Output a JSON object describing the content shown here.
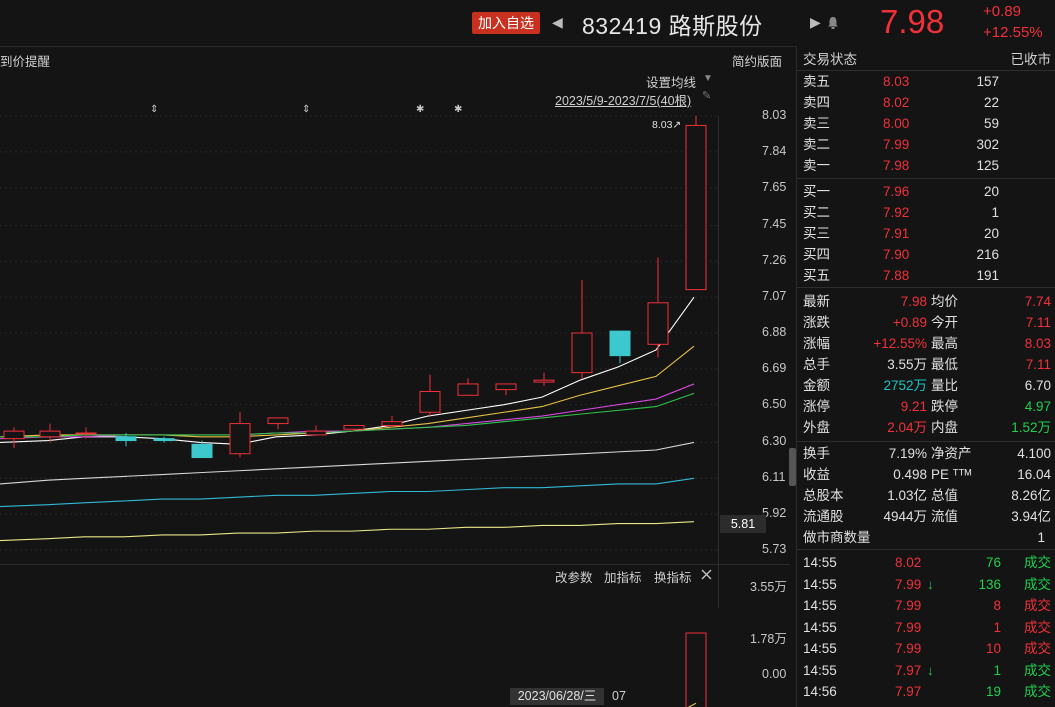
{
  "header": {
    "add_watch_label": "加入自选",
    "prev_arrow": "◀",
    "next_arrow": "▶",
    "code_name": "832419 路斯股份",
    "bell_icon": "bell-icon",
    "price": "7.98",
    "change": "+0.89",
    "change_pct": "+12.55%"
  },
  "chart": {
    "price_alert": "到价提醒",
    "simple_layout": "简约版面",
    "set_ma": "设置均线",
    "date_range": "2023/5/9-2023/7/5(40根)",
    "high_marker": "8.03",
    "current_price_tag": "5.81",
    "y_ticks": [
      "8.03",
      "7.84",
      "7.65",
      "7.45",
      "7.26",
      "7.07",
      "6.88",
      "6.69",
      "6.50",
      "6.30",
      "6.11",
      "5.92",
      "5.73"
    ],
    "indicator_menu": [
      "改参数",
      "加指标",
      "换指标"
    ],
    "close_icon": "close-icon",
    "vol_ticks": [
      "3.55万",
      "1.78万",
      "0.00"
    ],
    "cursor_date": "2023/06/28/三",
    "cursor_next": "07"
  },
  "chart_data": {
    "type": "candlestick",
    "ylim": [
      5.73,
      8.03
    ],
    "candles": [
      {
        "o": 6.32,
        "h": 6.38,
        "l": 6.27,
        "c": 6.36
      },
      {
        "o": 6.33,
        "h": 6.4,
        "l": 6.3,
        "c": 6.36
      },
      {
        "o": 6.35,
        "h": 6.38,
        "l": 6.32,
        "c": 6.35
      },
      {
        "o": 6.33,
        "h": 6.35,
        "l": 6.28,
        "c": 6.31
      },
      {
        "o": 6.32,
        "h": 6.33,
        "l": 6.3,
        "c": 6.31
      },
      {
        "o": 6.29,
        "h": 6.31,
        "l": 6.22,
        "c": 6.22
      },
      {
        "o": 6.24,
        "h": 6.46,
        "l": 6.22,
        "c": 6.4
      },
      {
        "o": 6.4,
        "h": 6.43,
        "l": 6.37,
        "c": 6.43
      },
      {
        "o": 6.34,
        "h": 6.39,
        "l": 6.34,
        "c": 6.36
      },
      {
        "o": 6.37,
        "h": 6.39,
        "l": 6.36,
        "c": 6.39
      },
      {
        "o": 6.39,
        "h": 6.44,
        "l": 6.38,
        "c": 6.41
      },
      {
        "o": 6.46,
        "h": 6.66,
        "l": 6.44,
        "c": 6.57
      },
      {
        "o": 6.55,
        "h": 6.64,
        "l": 6.55,
        "c": 6.61
      },
      {
        "o": 6.58,
        "h": 6.61,
        "l": 6.55,
        "c": 6.61
      },
      {
        "o": 6.62,
        "h": 6.67,
        "l": 6.6,
        "c": 6.63
      },
      {
        "o": 6.67,
        "h": 7.16,
        "l": 6.64,
        "c": 6.88
      },
      {
        "o": 6.89,
        "h": 6.89,
        "l": 6.72,
        "c": 6.76
      },
      {
        "o": 6.82,
        "h": 7.28,
        "l": 6.75,
        "c": 7.04
      },
      {
        "o": 7.11,
        "h": 8.03,
        "l": 7.11,
        "c": 7.98
      }
    ],
    "candle_x": [
      4,
      40,
      76,
      116,
      154,
      192,
      230,
      268,
      306,
      344,
      382,
      420,
      458,
      496,
      534,
      572,
      610,
      648,
      686
    ],
    "volumes": [
      0.06,
      0.05,
      0.05,
      0.06,
      0.05,
      0.05,
      0.37,
      0.12,
      0.1,
      0.05,
      0.07,
      0.28,
      0.1,
      0.1,
      0.13,
      0.72,
      0.3,
      0.7,
      3.55
    ],
    "vol_ylim": [
      0,
      3.55
    ],
    "ma_series": [
      {
        "color": "#ffffff",
        "values": [
          6.3,
          6.31,
          6.33,
          6.33,
          6.32,
          6.3,
          6.29,
          6.33,
          6.34,
          6.36,
          6.39,
          6.44,
          6.47,
          6.5,
          6.54,
          6.63,
          6.7,
          6.79,
          7.07
        ]
      },
      {
        "color": "#e8c14a",
        "values": [
          6.33,
          6.34,
          6.34,
          6.34,
          6.34,
          6.33,
          6.33,
          6.34,
          6.35,
          6.36,
          6.38,
          6.4,
          6.43,
          6.46,
          6.49,
          6.55,
          6.6,
          6.65,
          6.81
        ]
      },
      {
        "color": "#d848e0",
        "values": [
          6.32,
          6.33,
          6.33,
          6.34,
          6.34,
          6.34,
          6.34,
          6.35,
          6.36,
          6.36,
          6.37,
          6.38,
          6.4,
          6.42,
          6.44,
          6.47,
          6.5,
          6.53,
          6.61
        ]
      },
      {
        "color": "#2fc44a",
        "values": [
          6.33,
          6.33,
          6.34,
          6.34,
          6.34,
          6.34,
          6.34,
          6.35,
          6.35,
          6.36,
          6.37,
          6.38,
          6.39,
          6.41,
          6.43,
          6.45,
          6.47,
          6.49,
          6.56
        ]
      },
      {
        "color": "#d8d8d8",
        "values": [
          6.08,
          6.1,
          6.11,
          6.12,
          6.13,
          6.14,
          6.15,
          6.16,
          6.17,
          6.18,
          6.19,
          6.2,
          6.21,
          6.22,
          6.23,
          6.24,
          6.25,
          6.26,
          6.3
        ]
      },
      {
        "color": "#33b9d6",
        "values": [
          5.96,
          5.97,
          5.98,
          5.99,
          6.0,
          6.0,
          6.01,
          6.02,
          6.02,
          6.03,
          6.04,
          6.04,
          6.05,
          6.06,
          6.06,
          6.07,
          6.08,
          6.08,
          6.11
        ]
      },
      {
        "color": "#e6e98a",
        "values": [
          5.78,
          5.79,
          5.8,
          5.8,
          5.81,
          5.81,
          5.82,
          5.82,
          5.83,
          5.83,
          5.84,
          5.84,
          5.85,
          5.85,
          5.86,
          5.86,
          5.87,
          5.87,
          5.88
        ]
      }
    ],
    "vol_ma_series": [
      {
        "color": "#e8c14a",
        "values": [
          0.05,
          0.05,
          0.05,
          0.05,
          0.05,
          0.05,
          0.1,
          0.12,
          0.13,
          0.14,
          0.15,
          0.17,
          0.14,
          0.14,
          0.14,
          0.26,
          0.3,
          0.38,
          1.08
        ]
      },
      {
        "color": "#d848e0",
        "values": [
          0.05,
          0.05,
          0.05,
          0.05,
          0.05,
          0.05,
          0.07,
          0.08,
          0.09,
          0.09,
          0.1,
          0.12,
          0.12,
          0.13,
          0.13,
          0.17,
          0.2,
          0.26,
          0.6
        ]
      }
    ]
  },
  "quote": {
    "status_label": "交易状态",
    "status_value": "已收市",
    "asks": [
      {
        "label": "卖五",
        "price": "8.03",
        "vol": "157"
      },
      {
        "label": "卖四",
        "price": "8.02",
        "vol": "22"
      },
      {
        "label": "卖三",
        "price": "8.00",
        "vol": "59"
      },
      {
        "label": "卖二",
        "price": "7.99",
        "vol": "302"
      },
      {
        "label": "卖一",
        "price": "7.98",
        "vol": "125"
      }
    ],
    "bids": [
      {
        "label": "买一",
        "price": "7.96",
        "vol": "20"
      },
      {
        "label": "买二",
        "price": "7.92",
        "vol": "1"
      },
      {
        "label": "买三",
        "price": "7.91",
        "vol": "20"
      },
      {
        "label": "买四",
        "price": "7.90",
        "vol": "216"
      },
      {
        "label": "买五",
        "price": "7.88",
        "vol": "191"
      }
    ],
    "stats1": [
      {
        "l1": "最新",
        "v1": "7.98",
        "c1": "red",
        "l2": "均价",
        "v2": "7.74",
        "c2": "red"
      },
      {
        "l1": "涨跌",
        "v1": "+0.89",
        "c1": "red",
        "l2": "今开",
        "v2": "7.11",
        "c2": "red"
      },
      {
        "l1": "涨幅",
        "v1": "+12.55%",
        "c1": "red",
        "l2": "最高",
        "v2": "8.03",
        "c2": "red"
      },
      {
        "l1": "总手",
        "v1": "3.55万",
        "c1": "white",
        "l2": "最低",
        "v2": "7.11",
        "c2": "red"
      },
      {
        "l1": "金额",
        "v1": "2752万",
        "c1": "cyan",
        "l2": "量比",
        "v2": "6.70",
        "c2": "white"
      },
      {
        "l1": "涨停",
        "v1": "9.21",
        "c1": "red",
        "l2": "跌停",
        "v2": "4.97",
        "c2": "green"
      },
      {
        "l1": "外盘",
        "v1": "2.04万",
        "c1": "red",
        "l2": "内盘",
        "v2": "1.52万",
        "c2": "green"
      }
    ],
    "stats2": [
      {
        "l1": "换手",
        "v1": "7.19%",
        "l2": "净资产",
        "v2": "4.100"
      },
      {
        "l1": "收益",
        "v1": "0.498",
        "l2": "PE ᵀᵀᴹ",
        "v2": "16.04"
      },
      {
        "l1": "总股本",
        "v1": "1.03亿",
        "l2": "总值",
        "v2": "8.26亿"
      },
      {
        "l1": "流通股",
        "v1": "4944万",
        "l2": "流值",
        "v2": "3.94亿"
      }
    ],
    "market_makers_label": "做市商数量",
    "market_makers_value": "1",
    "ticks": [
      {
        "time": "14:55",
        "price": "8.02",
        "arrow": "",
        "vol": "76",
        "vc": "green",
        "type": "成交",
        "tc": "green"
      },
      {
        "time": "14:55",
        "price": "7.99",
        "arrow": "↓",
        "vol": "136",
        "vc": "green",
        "type": "成交",
        "tc": "green"
      },
      {
        "time": "14:55",
        "price": "7.99",
        "arrow": "",
        "vol": "8",
        "vc": "red",
        "type": "成交",
        "tc": "red"
      },
      {
        "time": "14:55",
        "price": "7.99",
        "arrow": "",
        "vol": "1",
        "vc": "red",
        "type": "成交",
        "tc": "red"
      },
      {
        "time": "14:55",
        "price": "7.99",
        "arrow": "",
        "vol": "10",
        "vc": "red",
        "type": "成交",
        "tc": "red"
      },
      {
        "time": "14:55",
        "price": "7.97",
        "arrow": "↓",
        "vol": "1",
        "vc": "green",
        "type": "成交",
        "tc": "green"
      },
      {
        "time": "14:56",
        "price": "7.97",
        "arrow": "",
        "vol": "19",
        "vc": "green",
        "type": "成交",
        "tc": "green"
      }
    ]
  }
}
